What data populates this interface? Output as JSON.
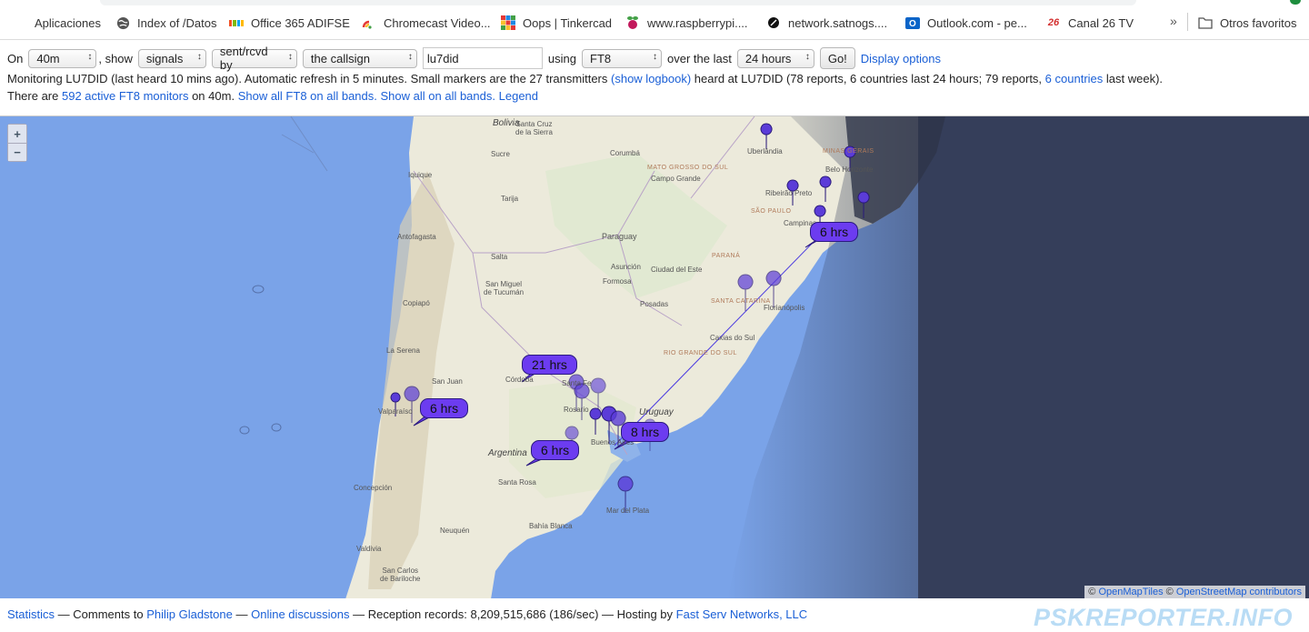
{
  "bookmarks": {
    "items": [
      {
        "label": "Aplicaciones",
        "icon": "apps-grid-icon"
      },
      {
        "label": "Index of /Datos",
        "icon": "globe-icon"
      },
      {
        "label": "Office 365 ADIFSE",
        "icon": "microsoft-icon"
      },
      {
        "label": "Chromecast Video...",
        "icon": "chromecast-icon"
      },
      {
        "label": "Oops | Tinkercad",
        "icon": "tinkercad-icon"
      },
      {
        "label": "www.raspberrypi....",
        "icon": "raspberry-icon"
      },
      {
        "label": "network.satnogs....",
        "icon": "satnogs-icon"
      },
      {
        "label": "Outlook.com - pe...",
        "icon": "outlook-icon"
      },
      {
        "label": "Canal 26 TV",
        "icon": "canal26-icon"
      }
    ],
    "more": "»",
    "other": "Otros favoritos"
  },
  "controls": {
    "on_label": "On",
    "band": "40m",
    "show_label": ", show",
    "show_value": "signals",
    "direction": "sent/rcvd by",
    "target": "the callsign",
    "callsign": "lu7did",
    "using_label": "using",
    "mode": "FT8",
    "over_label": "over the last",
    "period": "24 hours",
    "go": "Go!",
    "display_options": "Display options"
  },
  "info": {
    "line1_a": "Monitoring LU7DID (last heard 10 mins ago). Automatic refresh in 5 minutes. Small markers are the 27 transmitters",
    "logbook_link": "(show logbook)",
    "line1_b": "heard at LU7DID (78 reports, 6 countries last 24 hours; 79 reports,",
    "countries_link": "6 countries",
    "line1_c": "last week).",
    "line2_a": "There are",
    "monitors_link": "592 active FT8 monitors",
    "line2_b": "on 40m.",
    "all_bands_link": "Show all FT8 on all bands.",
    "all_link": "Show all on all bands.",
    "legend_link": "Legend"
  },
  "map": {
    "zoom_in": "+",
    "zoom_out": "−",
    "attribution_copy": "©",
    "attribution_a": "OpenMapTiles",
    "attribution_b": "OpenStreetMap contributors",
    "bubbles": [
      "6 hrs",
      "21 hrs",
      "6 hrs",
      "8 hrs",
      "6 hrs"
    ],
    "labels": {
      "santa_cruz": "Santa Cruz\nde la Sierra",
      "sucre": "Sucre",
      "bolivia": "Bolivia",
      "corumba": "Corumbá",
      "uberlandia": "Uberlândia",
      "mato_grosso": "MATO GROSSO DO SUL",
      "minas": "MINAS GERAIS",
      "belo": "Belo Horizonte",
      "campo_grande": "Campo Grande",
      "iquique": "Iquique",
      "tarija": "Tarija",
      "ribeirao": "Ribeirão Preto",
      "sao_paulo": "SÃO PAULO",
      "campinas": "Campinas",
      "paraguay": "Paraguay",
      "antofagasta": "Antofagasta",
      "salta": "Salta",
      "asuncion": "Asunción",
      "ciudad_este": "Ciudad del Este",
      "parana": "PARANÁ",
      "formosa": "Formosa",
      "tucuman": "San Miguel\nde Tucumán",
      "copiapo": "Copiapó",
      "posadas": "Posadas",
      "santa_catarina": "SANTA CATARINA",
      "florianopolis": "Florianópolis",
      "caxias": "Caxias do Sul",
      "rio_grande": "RIO GRANDE DO SUL",
      "la_serena": "La Serena",
      "cordoba": "Córdoba",
      "san_juan": "San Juan",
      "santa_fe": "Santa Fe",
      "rosario": "Rosario",
      "uruguay": "Uruguay",
      "valparaiso": "Valparaíso",
      "argentina": "Argentina",
      "buenos_aires": "Buenos Aires",
      "concepcion": "Concepción",
      "santa_rosa": "Santa Rosa",
      "mar_del_plata": "Mar del Plata",
      "bahia_blanca": "Bahía Blanca",
      "neuquen": "Neuquén",
      "valdivia": "Valdivia",
      "bariloche": "San Carlos\nde Bariloche"
    }
  },
  "footer": {
    "statistics": "Statistics",
    "comments_to": "— Comments to",
    "author": "Philip Gladstone",
    "sep1": "—",
    "discussions": "Online discussions",
    "records": "— Reception records: 8,209,515,686 (186/sec) — Hosting by",
    "host": "Fast Serv Networks, LLC",
    "brand": "PSKREPORTER.INFO"
  },
  "colors": {
    "ocean": "#7aa3e8",
    "land": "#eceadb",
    "night": "#353e5a",
    "marker": "#5b3cd8",
    "link": "#1a5fd6"
  }
}
